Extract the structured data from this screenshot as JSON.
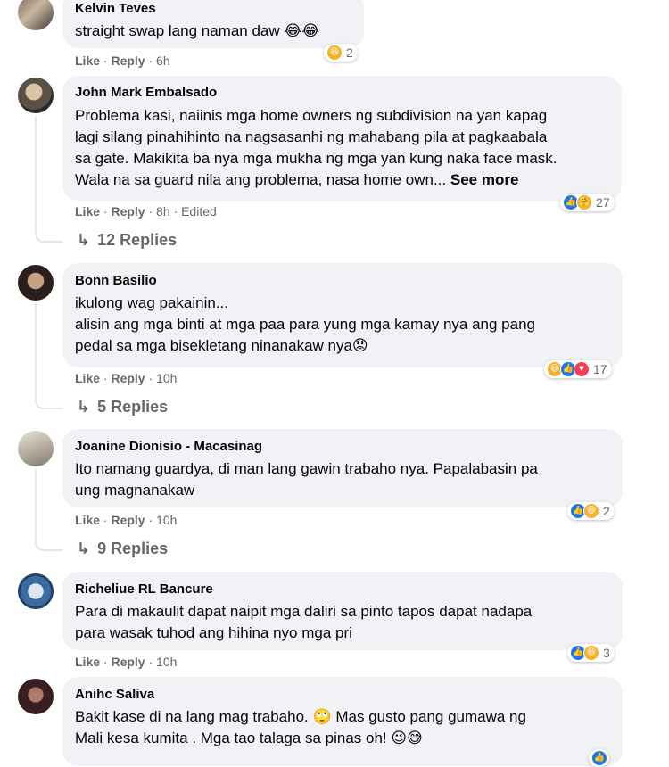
{
  "comments": [
    {
      "author": "Kelvin Teves",
      "lines": [
        "straight swap lang naman daw 😂😂"
      ],
      "like": "Like",
      "reply": "Reply",
      "time": "6h",
      "reaction_count": "2",
      "reaction_icons": [
        "haha-icon"
      ]
    },
    {
      "author": "John Mark Embalsado",
      "lines": [
        "Problema kasi, naiinis mga home owners ng subdivision na yan kapag",
        "lagi silang pinahihinto na nagsasanhi ng mahabang pila at pagkaabala",
        "sa gate. Makikita ba nya mga mukha ng mga yan kung naka face mask.",
        "Wala na sa guard nila ang problema, nasa home own..."
      ],
      "see_more": "See more",
      "like": "Like",
      "reply": "Reply",
      "time": "8h",
      "edited": "Edited",
      "reaction_count": "27",
      "reaction_icons": [
        "like-icon",
        "care-icon"
      ],
      "replies": "12 Replies"
    },
    {
      "author": "Bonn Basilio",
      "lines": [
        "ikulong wag pakainin...",
        "alisin ang mga binti at mga paa para yung mga kamay nya ang pang",
        "pedal sa mga bisekletang ninanakaw nya😡"
      ],
      "like": "Like",
      "reply": "Reply",
      "time": "10h",
      "reaction_count": "17",
      "reaction_icons": [
        "haha-icon",
        "like-icon",
        "love-icon"
      ],
      "replies": "5 Replies"
    },
    {
      "author": "Joanine Dionisio - Macasinag",
      "lines": [
        "Ito namang guardya, di man lang gawin trabaho nya. Papalabasin pa",
        "ung magnanakaw"
      ],
      "like": "Like",
      "reply": "Reply",
      "time": "10h",
      "reaction_count": "2",
      "reaction_icons": [
        "like-icon",
        "haha-icon"
      ],
      "replies": "9 Replies"
    },
    {
      "author": "Richeliue RL Bancure",
      "lines": [
        "Para di makaulit dapat naipit mga daliri sa pinto tapos dapat nadapa",
        "para wasak tuhod ang hihina nyo mga pri"
      ],
      "like": "Like",
      "reply": "Reply",
      "time": "10h",
      "reaction_count": "3",
      "reaction_icons": [
        "like-icon",
        "haha-icon"
      ]
    },
    {
      "author": "Anihc Saliva",
      "lines": [
        "Bakit kase di na lang mag trabaho. 🙄 Mas gusto pang gumawa ng",
        "Mali kesa kumita . Mga tao talaga sa pinas oh! 😉😅"
      ]
    }
  ],
  "colors": {
    "bubble": "#f0f2f5",
    "meta": "#65676b",
    "like": "#1877f2",
    "haha": "#f7b125",
    "love": "#f33e58"
  }
}
